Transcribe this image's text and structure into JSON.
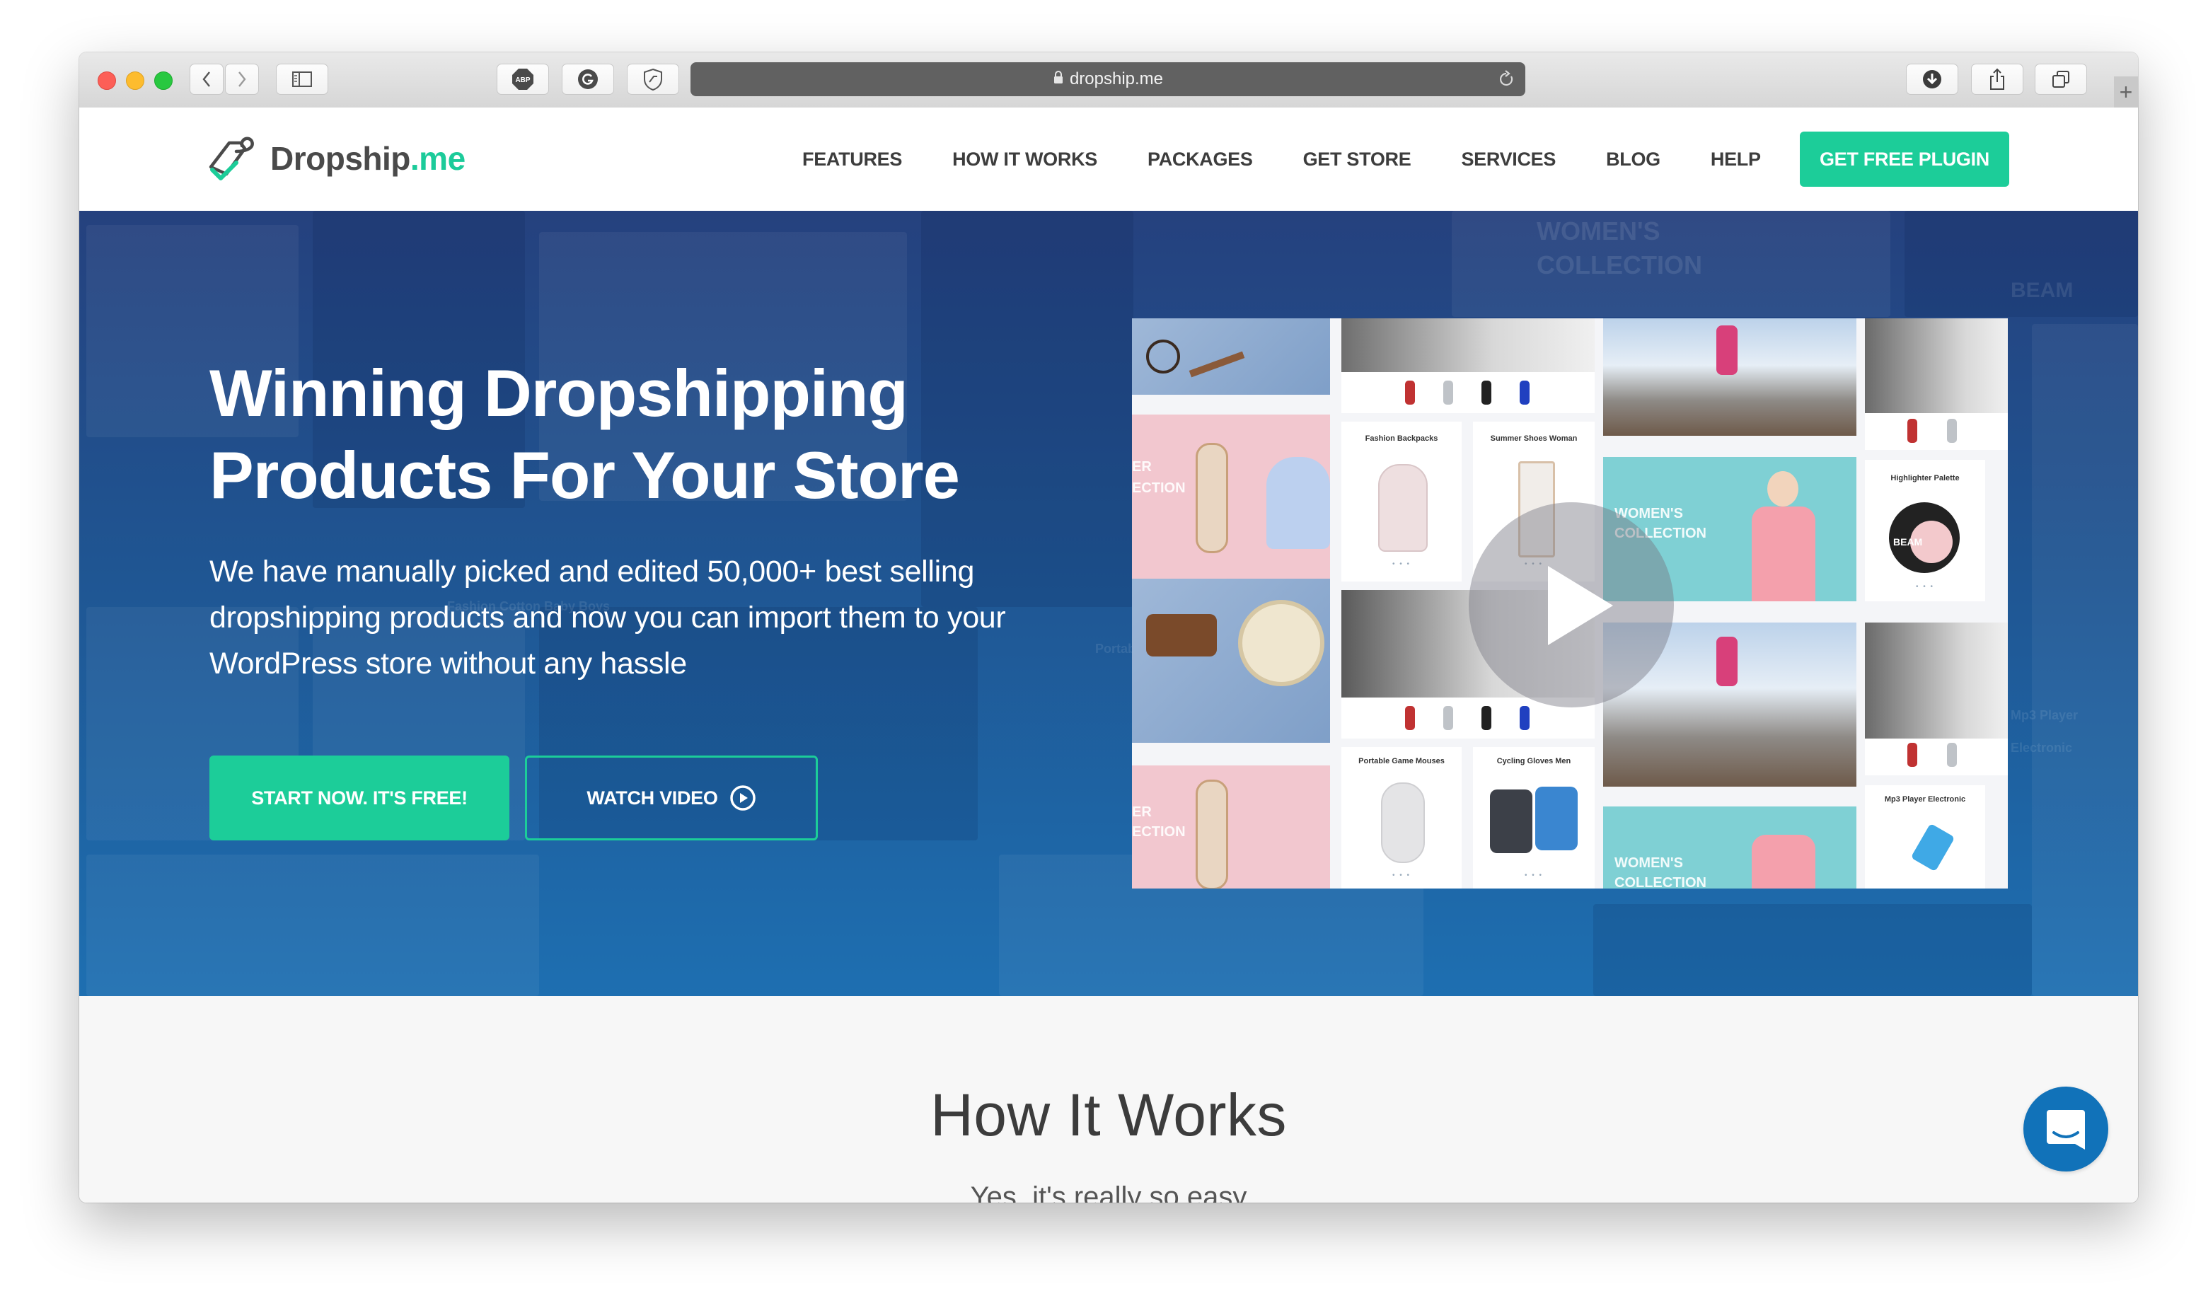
{
  "browser": {
    "url": "dropship.me",
    "toolbar_icons": [
      "back-icon",
      "forward-icon",
      "sidebar-icon",
      "adblock-plus-icon",
      "grammarly-icon",
      "shield-extension-icon",
      "lock-icon",
      "reload-icon",
      "download-icon",
      "share-icon",
      "tabs-icon",
      "new-tab-icon"
    ],
    "extension_abp_label": "ABP",
    "new_tab_label": "+"
  },
  "nav": {
    "logo_main": "Dropship",
    "logo_tld": ".me",
    "links": [
      "FEATURES",
      "HOW IT WORKS",
      "PACKAGES",
      "GET STORE",
      "SERVICES",
      "BLOG",
      "HELP"
    ],
    "cta": "GET FREE PLUGIN"
  },
  "hero": {
    "title_line1": "Winning Dropshipping",
    "title_line2": "Products For Your Store",
    "description": "We have manually picked and edited 50,000+ best selling dropshipping products and now you can import them to your WordPress store without any hassle",
    "start_button": "START NOW. IT'S FREE!",
    "watch_button": "WATCH VIDEO",
    "background_texts": [
      "WOMEN'S",
      "COLLECTION",
      "BEAM",
      "Mp3 Player Electronic",
      "Fashion Cotton Baby Boys",
      "Portab"
    ]
  },
  "video": {
    "cards": [
      {
        "title": "Fashion Backpacks"
      },
      {
        "title": "Summer Shoes Woman"
      },
      {
        "title": "Highlighter Palette"
      },
      {
        "title": "Portable Game Mouses"
      },
      {
        "title": "Cycling Gloves Men"
      },
      {
        "title": "Mp3 Player Electronic"
      }
    ],
    "collection_label_1": "WOMEN'S",
    "collection_label_2": "COLLECTION",
    "summer_label_1": "ER",
    "summer_label_2": "ECTION",
    "beam_label": "BEAM",
    "dots": "• • •"
  },
  "how_it_works": {
    "title": "How It Works",
    "subtitle": "Yes, it's really so easy"
  },
  "colors": {
    "brand_green": "#1ccd99",
    "hero_blue": "#1f5592",
    "chat_blue": "#1172b9",
    "text_dark": "#3d3d3d"
  }
}
